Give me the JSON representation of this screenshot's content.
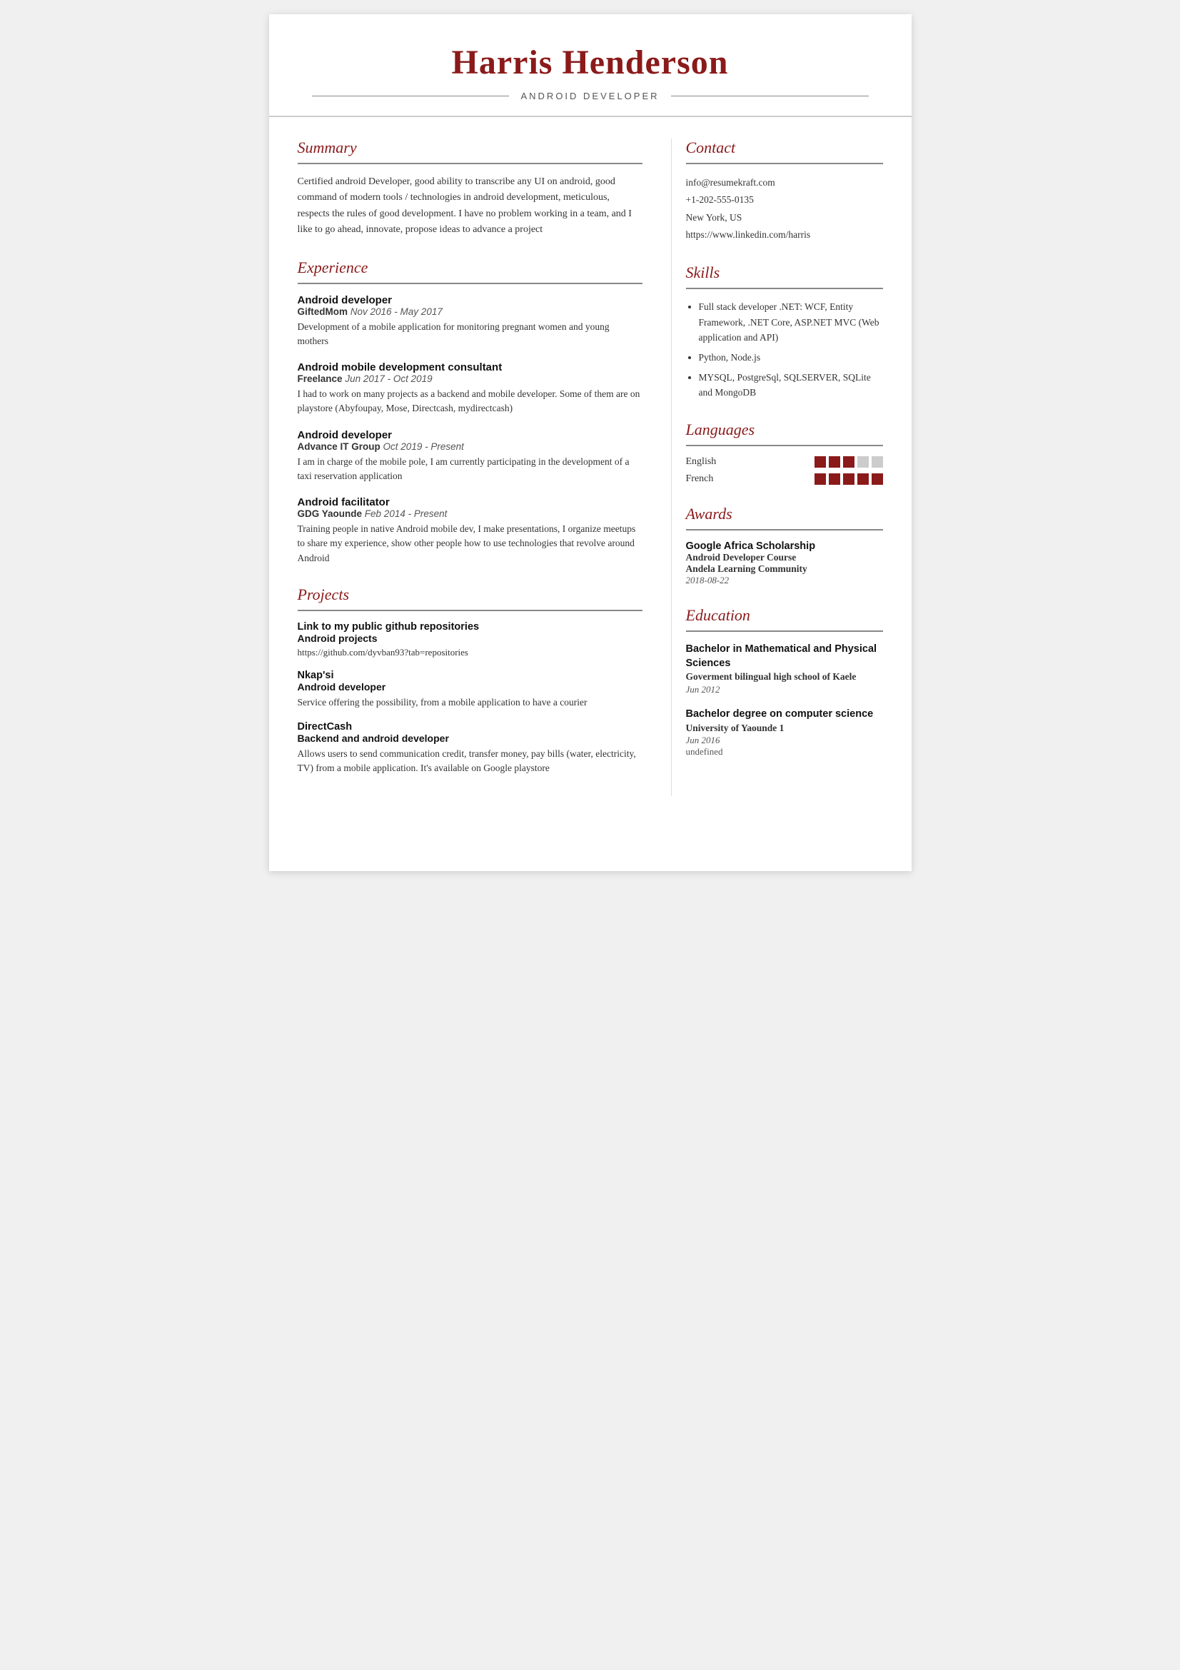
{
  "header": {
    "name": "Harris Henderson",
    "subtitle": "ANDROID DEVELOPER"
  },
  "summary": {
    "section_title": "Summary",
    "text": "Certified android Developer, good ability to transcribe any UI on android, good command of modern tools / technologies in android development, meticulous, respects the rules of good development. I have no problem working in a team, and I like to go ahead, innovate, propose ideas to advance a project"
  },
  "experience": {
    "section_title": "Experience",
    "items": [
      {
        "title": "Android developer",
        "company": "GiftedMom",
        "dates": "Nov 2016 - May 2017",
        "description": "Development of a mobile application for monitoring pregnant women and young mothers"
      },
      {
        "title": "Android mobile development consultant",
        "company": "Freelance",
        "dates": "Jun 2017 - Oct 2019",
        "description": "I had to work on many projects as a backend and mobile developer. Some of them are on playstore (Abyfoupay, Mose, Directcash, mydirectcash)"
      },
      {
        "title": "Android developer",
        "company": "Advance IT Group",
        "dates": "Oct 2019 - Present",
        "description": "I am in charge of the mobile pole, I am currently participating in the development of a taxi reservation application"
      },
      {
        "title": "Android facilitator",
        "company": "GDG Yaounde",
        "dates": "Feb 2014 - Present",
        "description": "Training people in native Android mobile dev, I make presentations, I organize meetups to share my experience, show other people how to use technologies that revolve around Android"
      }
    ]
  },
  "projects": {
    "section_title": "Projects",
    "items": [
      {
        "title": "Link to my public github repositories",
        "subtitle": "Android projects",
        "link": "https://github.com/dyvban93?tab=repositories",
        "description": ""
      },
      {
        "title": "Nkap'si",
        "subtitle": "Android developer",
        "link": "",
        "description": "Service offering the possibility, from a mobile application to have a courier"
      },
      {
        "title": "DirectCash",
        "subtitle": "Backend and android developer",
        "link": "",
        "description": "Allows users to send communication credit, transfer money, pay bills (water, electricity, TV) from a mobile application. It's available on Google playstore"
      }
    ]
  },
  "contact": {
    "section_title": "Contact",
    "email": "info@resumekraft.com",
    "phone": "+1-202-555-0135",
    "location": "New York, US",
    "linkedin": "https://www.linkedin.com/harris"
  },
  "skills": {
    "section_title": "Skills",
    "items": [
      "Full stack developer .NET: WCF, Entity Framework, .NET Core, ASP.NET MVC (Web application and API)",
      "Python, Node.js",
      "MYSQL, PostgreSql, SQLSERVER, SQLite and MongoDB"
    ]
  },
  "languages": {
    "section_title": "Languages",
    "items": [
      {
        "name": "English",
        "filled": 3,
        "empty": 2
      },
      {
        "name": "French",
        "filled": 5,
        "empty": 0
      }
    ]
  },
  "awards": {
    "section_title": "Awards",
    "title": "Google Africa Scholarship",
    "line2": "Android Developer Course",
    "line3": "Andela Learning Community",
    "date": "2018-08-22"
  },
  "education": {
    "section_title": "Education",
    "items": [
      {
        "degree": "Bachelor in Mathematical and Physical Sciences",
        "school": "Goverment bilingual high school of Kaele",
        "date": "Jun 2012",
        "extra": ""
      },
      {
        "degree": "Bachelor degree on computer science",
        "school": "University of Yaounde 1",
        "date": "Jun 2016",
        "extra": "undefined"
      }
    ]
  }
}
